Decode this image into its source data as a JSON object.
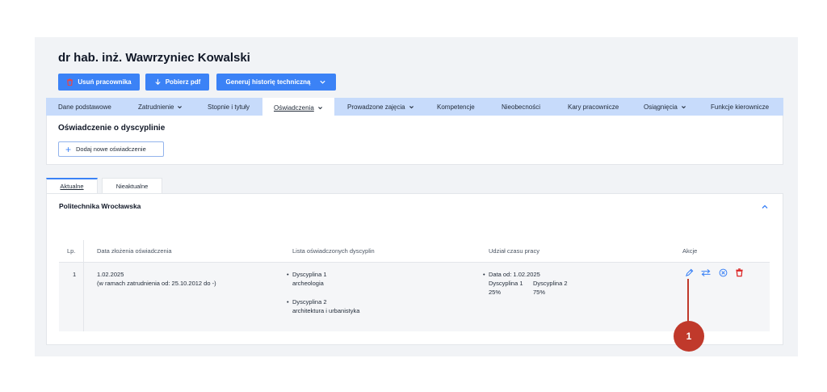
{
  "header": {
    "person_name": "dr hab. inż. Wawrzyniec Kowalski"
  },
  "actions": {
    "delete_employee": "Usuń pracownika",
    "download_pdf": "Pobierz pdf",
    "generate_history": "Generuj historię techniczną"
  },
  "nav_tabs": [
    {
      "label": "Dane podstawowe"
    },
    {
      "label": "Zatrudnienie"
    },
    {
      "label": "Stopnie i tytuły"
    },
    {
      "label": "Oświadczenia"
    },
    {
      "label": "Prowadzone zajęcia"
    },
    {
      "label": "Kompetencje"
    },
    {
      "label": "Nieobecności"
    },
    {
      "label": "Kary pracownicze"
    },
    {
      "label": "Osiągnięcia"
    },
    {
      "label": "Funkcje kierownicze"
    }
  ],
  "declaration": {
    "title": "Oświadczenie o dyscyplinie",
    "add_button": "Dodaj nowe oświadczenie"
  },
  "subtabs": {
    "current": "Aktualne",
    "outdated": "Nieaktualne"
  },
  "section": {
    "organization": "Politechnika Wrocławska"
  },
  "table": {
    "headers": [
      "Lp.",
      "Data złożenia oświadczenia",
      "Lista oświadczonych dyscyplin",
      "Udział czasu pracy",
      "Akcje"
    ],
    "rows": [
      {
        "lp": "1",
        "date": "1.02.2025",
        "date_note": "(w ramach zatrudnienia od: 25.10.2012 do -)",
        "disciplines": [
          {
            "label": "Dyscyplina 1",
            "value": "archeologia"
          },
          {
            "label": "Dyscyplina 2",
            "value": "architektura i urbanistyka"
          }
        ],
        "share": {
          "date_from": "Data od: 1.02.2025",
          "col1_label": "Dyscyplina 1",
          "col1_value": "25%",
          "col2_label": "Dyscyplina 2",
          "col2_value": "75%"
        }
      }
    ]
  },
  "callout": {
    "number": "1"
  },
  "colors": {
    "primary": "#3b82f6",
    "danger": "#dc2626",
    "marker": "#c0392b",
    "tabbar": "#c7dbfb"
  }
}
